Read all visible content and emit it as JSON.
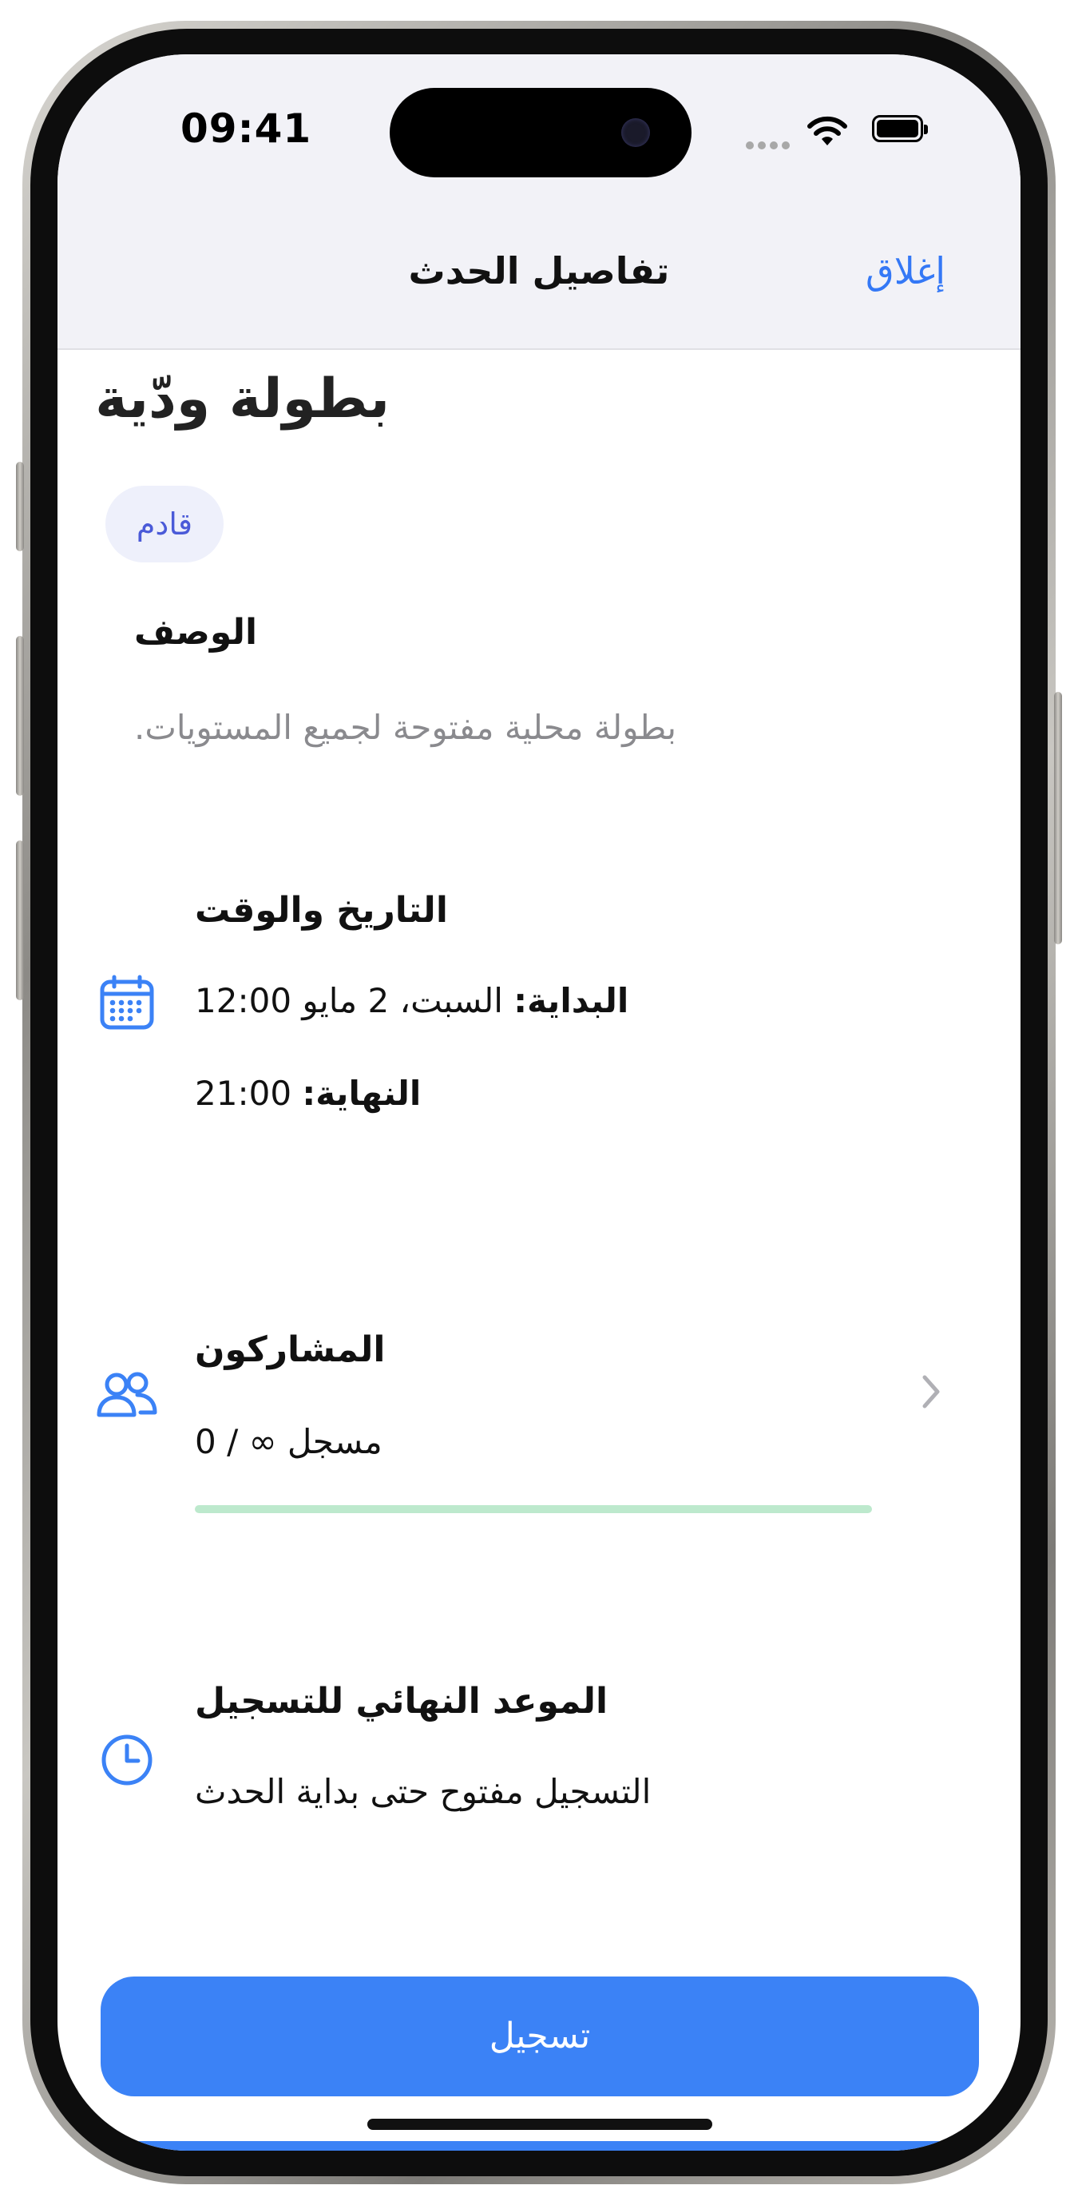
{
  "status_bar": {
    "time": "09:41"
  },
  "nav": {
    "title": "تفاصيل الحدث",
    "close_label": "إغلاق"
  },
  "event": {
    "title": "بطولة ودّية",
    "status_badge": "قادم",
    "description_label": "الوصف",
    "description": "بطولة محلية مفتوحة لجميع المستويات."
  },
  "datetime": {
    "label": "التاريخ والوقت",
    "start_label": "البداية:",
    "start_value": " السبت، 2 مايو 12:00",
    "end_label": "النهاية:",
    "end_value": " 21:00",
    "icon": "calendar-icon"
  },
  "participants": {
    "label": "المشاركون",
    "count_text": "مسجل ∞ / 0",
    "progress": 0,
    "icon": "people-icon"
  },
  "deadline": {
    "label": "الموعد النهائي للتسجيل",
    "text": "التسجيل مفتوح حتى بداية الحدث",
    "icon": "clock-icon"
  },
  "actions": {
    "register_label": "تسجيل"
  },
  "colors": {
    "accent": "#3b82f6",
    "link": "#3478f6",
    "badge_bg": "#eef0fb",
    "badge_text": "#4a5ad8",
    "progress_track": "#bde9cd"
  }
}
